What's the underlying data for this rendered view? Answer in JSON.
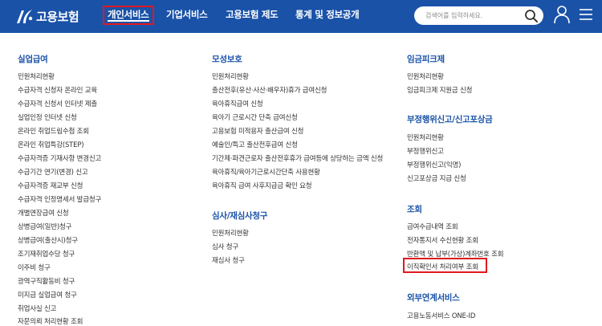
{
  "brand": {
    "name": "고용보험"
  },
  "nav": [
    {
      "label": "개인서비스"
    },
    {
      "label": "기업서비스"
    },
    {
      "label": "고용보험 제도"
    },
    {
      "label": "통계 및 정보공개"
    }
  ],
  "search": {
    "placeholder": "검색어를 입력하세요."
  },
  "icons": {
    "search": "search-icon",
    "user": "user-icon",
    "menu": "hamburger-menu-icon"
  },
  "colors": {
    "header": "#1a52a8",
    "category": "#1a52a8",
    "highlight": "#e0191f"
  },
  "columns": [
    {
      "sections": [
        {
          "title": "실업급여",
          "links": [
            "민원처리현황",
            "수급자격 신청자 온라인 교육",
            "수급자격 신청서 인터넷 제출",
            "실업인정 인터넷 신청",
            "온라인 취업드림수첩 조회",
            "온라인 취업특강(STEP)",
            "수급자격증 기재사항 변경신고",
            "수급기간 연기(변경) 신고",
            "수급자격증 재교부 신청",
            "수급자격 인정명세서 발급청구",
            "개별연장급여 신청",
            "상병급여(일반)청구",
            "상병급여(출산시)청구",
            "조기재취업수당 청구",
            "이주비 청구",
            "광역구직활동비 청구",
            "미지급 실업급여 청구",
            "취업사실 신고",
            "자문의뢰 처리현황 조회"
          ]
        }
      ]
    },
    {
      "sections": [
        {
          "title": "모성보호",
          "links": [
            "민원처리현황",
            "출산전후(유산·사산·배우자)휴가 급여신청",
            "육아휴직급여 신청",
            "육아기 근로시간 단축 급여신청",
            "고용보험 미적용자 출산급여 신청",
            "예술인/특고 출산전후급여 신청",
            "기간제·파견근로자 출산전후휴가 급여등에 상당하는 금액 신청",
            "육아휴직/육아기근로시간단축 사용현황",
            "육아휴직 급여 사후지급금 확인 요청"
          ]
        },
        {
          "title": "심사/재심사청구",
          "links": [
            "민원처리현황",
            "심사 청구",
            "재심사 청구"
          ]
        }
      ]
    },
    {
      "sections": [
        {
          "title": "임금피크제",
          "links": [
            "민원처리현황",
            "임금피크제 지원금 신청"
          ]
        },
        {
          "title": "부정행위신고/신고포상금",
          "links": [
            "민원처리현황",
            "부정행위신고",
            "부정행위신고(익명)",
            "신고포상금 지급 신청"
          ]
        },
        {
          "title": "조회",
          "links": [
            "급여수급내역 조회",
            "전자통지서 수신현황 조회",
            "반환액 및 납부(가상)계좌번호 조회",
            "이직확인서 처리여부 조회"
          ]
        },
        {
          "title": "외부연계서비스",
          "links": [
            "고용노동서비스 ONE-ID"
          ]
        }
      ]
    }
  ]
}
